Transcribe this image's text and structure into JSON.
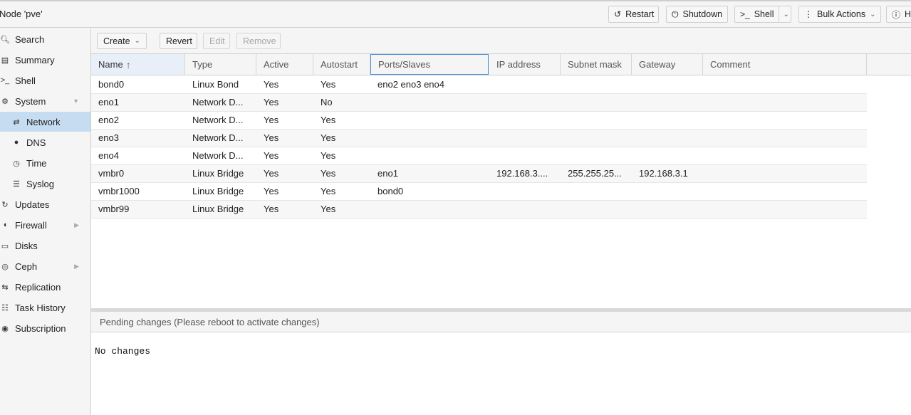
{
  "header": {
    "node_title": "Node 'pve'",
    "buttons": [
      {
        "label": "Restart",
        "icon": "restart-icon"
      },
      {
        "label": "Shutdown",
        "icon": "power-icon"
      },
      {
        "label": "Shell",
        "icon": "terminal-icon"
      },
      {
        "label": "Bulk Actions",
        "icon": "more-vertical-icon"
      },
      {
        "label": "H",
        "icon": "help-icon"
      }
    ]
  },
  "sidebar": {
    "items": [
      {
        "label": "Search",
        "icon": "search-icon"
      },
      {
        "label": "Summary",
        "icon": "book-icon"
      },
      {
        "label": "Shell",
        "icon": "terminal-icon"
      },
      {
        "label": "System",
        "icon": "gears-icon"
      },
      {
        "label": "Network",
        "icon": "exchange-icon"
      },
      {
        "label": "DNS",
        "icon": "globe-icon"
      },
      {
        "label": "Time",
        "icon": "clock-icon"
      },
      {
        "label": "Syslog",
        "icon": "list-icon"
      },
      {
        "label": "Updates",
        "icon": "refresh-icon"
      },
      {
        "label": "Firewall",
        "icon": "shield-icon"
      },
      {
        "label": "Disks",
        "icon": "hdd-icon"
      },
      {
        "label": "Ceph",
        "icon": "ceph-icon"
      },
      {
        "label": "Replication",
        "icon": "retweet-icon"
      },
      {
        "label": "Task History",
        "icon": "list-alt-icon"
      },
      {
        "label": "Subscription",
        "icon": "support-icon"
      }
    ],
    "selected": "Network"
  },
  "toolbar": {
    "create_label": "Create",
    "revert_label": "Revert",
    "edit_label": "Edit",
    "remove_label": "Remove"
  },
  "grid": {
    "columns": [
      "Name",
      "Type",
      "Active",
      "Autostart",
      "Ports/Slaves",
      "IP address",
      "Subnet mask",
      "Gateway",
      "Comment"
    ],
    "rows": [
      [
        "bond0",
        "Linux Bond",
        "Yes",
        "Yes",
        "eno2 eno3 eno4",
        "",
        "",
        "",
        ""
      ],
      [
        "eno1",
        "Network D...",
        "Yes",
        "No",
        "",
        "",
        "",
        "",
        ""
      ],
      [
        "eno2",
        "Network D...",
        "Yes",
        "Yes",
        "",
        "",
        "",
        "",
        ""
      ],
      [
        "eno3",
        "Network D...",
        "Yes",
        "Yes",
        "",
        "",
        "",
        "",
        ""
      ],
      [
        "eno4",
        "Network D...",
        "Yes",
        "Yes",
        "",
        "",
        "",
        "",
        ""
      ],
      [
        "vmbr0",
        "Linux Bridge",
        "Yes",
        "Yes",
        "eno1",
        "192.168.3....",
        "255.255.25...",
        "192.168.3.1",
        ""
      ],
      [
        "vmbr1000",
        "Linux Bridge",
        "Yes",
        "Yes",
        "bond0",
        "",
        "",
        "",
        ""
      ],
      [
        "vmbr99",
        "Linux Bridge",
        "Yes",
        "Yes",
        "",
        "",
        "",
        "",
        ""
      ]
    ]
  },
  "pending": {
    "title": "Pending changes (Please reboot to activate changes)",
    "body": "No changes"
  }
}
